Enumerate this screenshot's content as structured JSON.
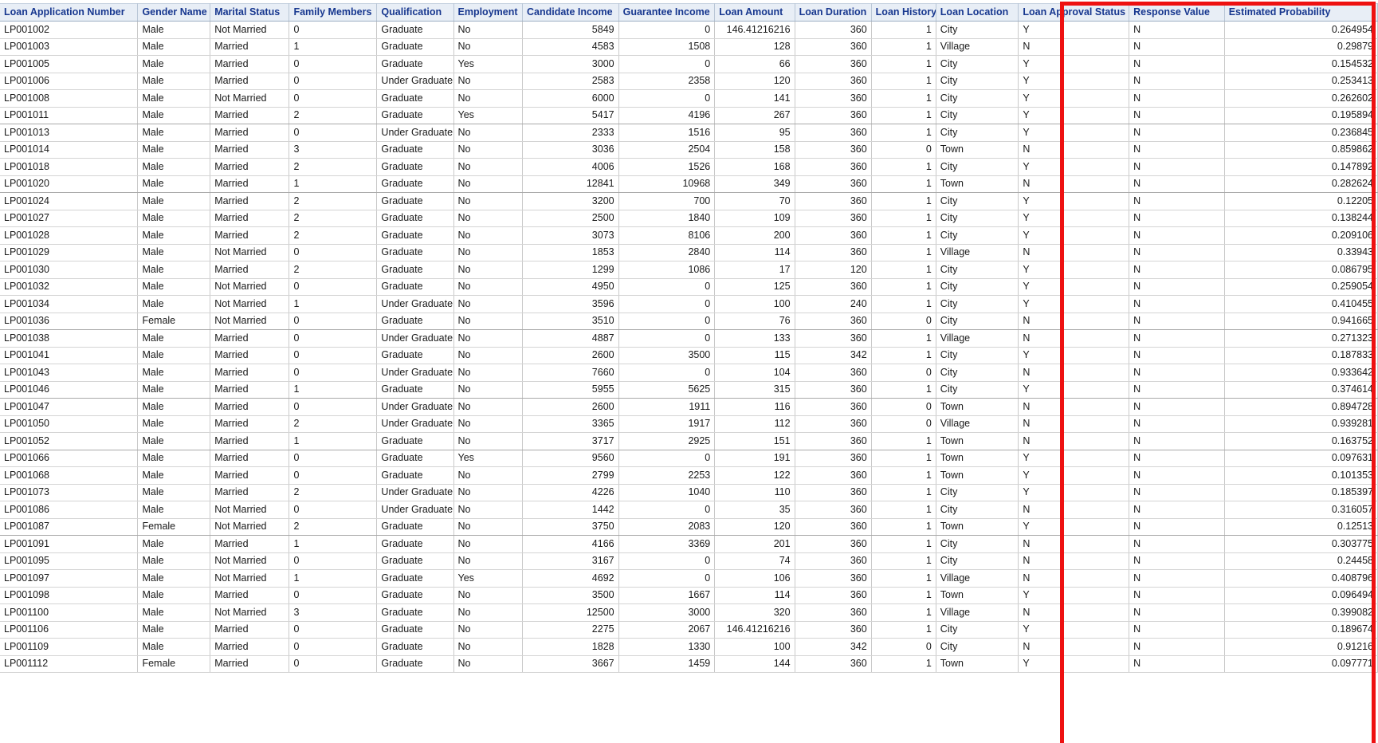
{
  "table": {
    "columns": [
      {
        "key": "loan_application_number",
        "label": "Loan Application Number",
        "align": "left"
      },
      {
        "key": "gender_name",
        "label": "Gender Name",
        "align": "left"
      },
      {
        "key": "marital_status",
        "label": "Marital Status",
        "align": "left"
      },
      {
        "key": "family_members",
        "label": "Family Members",
        "align": "left"
      },
      {
        "key": "qualification",
        "label": "Qualification",
        "align": "left"
      },
      {
        "key": "employment",
        "label": "Employment",
        "align": "left"
      },
      {
        "key": "candidate_income",
        "label": "Candidate Income",
        "align": "right"
      },
      {
        "key": "guarantee_income",
        "label": "Guarantee Income",
        "align": "right"
      },
      {
        "key": "loan_amount",
        "label": "Loan Amount",
        "align": "right"
      },
      {
        "key": "loan_duration",
        "label": "Loan Duration",
        "align": "right"
      },
      {
        "key": "loan_history",
        "label": "Loan History",
        "align": "right"
      },
      {
        "key": "loan_location",
        "label": "Loan Location",
        "align": "left"
      },
      {
        "key": "loan_approval_status",
        "label": "Loan Approval Status",
        "align": "left"
      },
      {
        "key": "response_value",
        "label": "Response Value",
        "align": "left"
      },
      {
        "key": "estimated_probability",
        "label": "Estimated Probability",
        "align": "right"
      }
    ],
    "rows": [
      [
        "LP001002",
        "Male",
        "Not Married",
        "0",
        "Graduate",
        "No",
        "5849",
        "0",
        "146.41216216",
        "360",
        "1",
        "City",
        "Y",
        "N",
        "0.264954"
      ],
      [
        "LP001003",
        "Male",
        "Married",
        "1",
        "Graduate",
        "No",
        "4583",
        "1508",
        "128",
        "360",
        "1",
        "Village",
        "N",
        "N",
        "0.29879"
      ],
      [
        "LP001005",
        "Male",
        "Married",
        "0",
        "Graduate",
        "Yes",
        "3000",
        "0",
        "66",
        "360",
        "1",
        "City",
        "Y",
        "N",
        "0.154532"
      ],
      [
        "LP001006",
        "Male",
        "Married",
        "0",
        "Under Graduate",
        "No",
        "2583",
        "2358",
        "120",
        "360",
        "1",
        "City",
        "Y",
        "N",
        "0.253413"
      ],
      [
        "LP001008",
        "Male",
        "Not Married",
        "0",
        "Graduate",
        "No",
        "6000",
        "0",
        "141",
        "360",
        "1",
        "City",
        "Y",
        "N",
        "0.262602"
      ],
      [
        "LP001011",
        "Male",
        "Married",
        "2",
        "Graduate",
        "Yes",
        "5417",
        "4196",
        "267",
        "360",
        "1",
        "City",
        "Y",
        "N",
        "0.195894"
      ],
      [
        "LP001013",
        "Male",
        "Married",
        "0",
        "Under Graduate",
        "No",
        "2333",
        "1516",
        "95",
        "360",
        "1",
        "City",
        "Y",
        "N",
        "0.236845"
      ],
      [
        "LP001014",
        "Male",
        "Married",
        "3",
        "Graduate",
        "No",
        "3036",
        "2504",
        "158",
        "360",
        "0",
        "Town",
        "N",
        "N",
        "0.859862"
      ],
      [
        "LP001018",
        "Male",
        "Married",
        "2",
        "Graduate",
        "No",
        "4006",
        "1526",
        "168",
        "360",
        "1",
        "City",
        "Y",
        "N",
        "0.147892"
      ],
      [
        "LP001020",
        "Male",
        "Married",
        "1",
        "Graduate",
        "No",
        "12841",
        "10968",
        "349",
        "360",
        "1",
        "Town",
        "N",
        "N",
        "0.282624"
      ],
      [
        "LP001024",
        "Male",
        "Married",
        "2",
        "Graduate",
        "No",
        "3200",
        "700",
        "70",
        "360",
        "1",
        "City",
        "Y",
        "N",
        "0.12205"
      ],
      [
        "LP001027",
        "Male",
        "Married",
        "2",
        "Graduate",
        "No",
        "2500",
        "1840",
        "109",
        "360",
        "1",
        "City",
        "Y",
        "N",
        "0.138244"
      ],
      [
        "LP001028",
        "Male",
        "Married",
        "2",
        "Graduate",
        "No",
        "3073",
        "8106",
        "200",
        "360",
        "1",
        "City",
        "Y",
        "N",
        "0.209106"
      ],
      [
        "LP001029",
        "Male",
        "Not Married",
        "0",
        "Graduate",
        "No",
        "1853",
        "2840",
        "114",
        "360",
        "1",
        "Village",
        "N",
        "N",
        "0.33943"
      ],
      [
        "LP001030",
        "Male",
        "Married",
        "2",
        "Graduate",
        "No",
        "1299",
        "1086",
        "17",
        "120",
        "1",
        "City",
        "Y",
        "N",
        "0.086795"
      ],
      [
        "LP001032",
        "Male",
        "Not Married",
        "0",
        "Graduate",
        "No",
        "4950",
        "0",
        "125",
        "360",
        "1",
        "City",
        "Y",
        "N",
        "0.259054"
      ],
      [
        "LP001034",
        "Male",
        "Not Married",
        "1",
        "Under Graduate",
        "No",
        "3596",
        "0",
        "100",
        "240",
        "1",
        "City",
        "Y",
        "N",
        "0.410455"
      ],
      [
        "LP001036",
        "Female",
        "Not Married",
        "0",
        "Graduate",
        "No",
        "3510",
        "0",
        "76",
        "360",
        "0",
        "City",
        "N",
        "N",
        "0.941665"
      ],
      [
        "LP001038",
        "Male",
        "Married",
        "0",
        "Under Graduate",
        "No",
        "4887",
        "0",
        "133",
        "360",
        "1",
        "Village",
        "N",
        "N",
        "0.271323"
      ],
      [
        "LP001041",
        "Male",
        "Married",
        "0",
        "Graduate",
        "No",
        "2600",
        "3500",
        "115",
        "342",
        "1",
        "City",
        "Y",
        "N",
        "0.187833"
      ],
      [
        "LP001043",
        "Male",
        "Married",
        "0",
        "Under Graduate",
        "No",
        "7660",
        "0",
        "104",
        "360",
        "0",
        "City",
        "N",
        "N",
        "0.933642"
      ],
      [
        "LP001046",
        "Male",
        "Married",
        "1",
        "Graduate",
        "No",
        "5955",
        "5625",
        "315",
        "360",
        "1",
        "City",
        "Y",
        "N",
        "0.374614"
      ],
      [
        "LP001047",
        "Male",
        "Married",
        "0",
        "Under Graduate",
        "No",
        "2600",
        "1911",
        "116",
        "360",
        "0",
        "Town",
        "N",
        "N",
        "0.894728"
      ],
      [
        "LP001050",
        "Male",
        "Married",
        "2",
        "Under Graduate",
        "No",
        "3365",
        "1917",
        "112",
        "360",
        "0",
        "Village",
        "N",
        "N",
        "0.939281"
      ],
      [
        "LP001052",
        "Male",
        "Married",
        "1",
        "Graduate",
        "No",
        "3717",
        "2925",
        "151",
        "360",
        "1",
        "Town",
        "N",
        "N",
        "0.163752"
      ],
      [
        "LP001066",
        "Male",
        "Married",
        "0",
        "Graduate",
        "Yes",
        "9560",
        "0",
        "191",
        "360",
        "1",
        "Town",
        "Y",
        "N",
        "0.097631"
      ],
      [
        "LP001068",
        "Male",
        "Married",
        "0",
        "Graduate",
        "No",
        "2799",
        "2253",
        "122",
        "360",
        "1",
        "Town",
        "Y",
        "N",
        "0.101353"
      ],
      [
        "LP001073",
        "Male",
        "Married",
        "2",
        "Under Graduate",
        "No",
        "4226",
        "1040",
        "110",
        "360",
        "1",
        "City",
        "Y",
        "N",
        "0.185397"
      ],
      [
        "LP001086",
        "Male",
        "Not Married",
        "0",
        "Under Graduate",
        "No",
        "1442",
        "0",
        "35",
        "360",
        "1",
        "City",
        "N",
        "N",
        "0.316057"
      ],
      [
        "LP001087",
        "Female",
        "Not Married",
        "2",
        "Graduate",
        "No",
        "3750",
        "2083",
        "120",
        "360",
        "1",
        "Town",
        "Y",
        "N",
        "0.12513"
      ],
      [
        "LP001091",
        "Male",
        "Married",
        "1",
        "Graduate",
        "No",
        "4166",
        "3369",
        "201",
        "360",
        "1",
        "City",
        "N",
        "N",
        "0.303775"
      ],
      [
        "LP001095",
        "Male",
        "Not Married",
        "0",
        "Graduate",
        "No",
        "3167",
        "0",
        "74",
        "360",
        "1",
        "City",
        "N",
        "N",
        "0.24458"
      ],
      [
        "LP001097",
        "Male",
        "Not Married",
        "1",
        "Graduate",
        "Yes",
        "4692",
        "0",
        "106",
        "360",
        "1",
        "Village",
        "N",
        "N",
        "0.408796"
      ],
      [
        "LP001098",
        "Male",
        "Married",
        "0",
        "Graduate",
        "No",
        "3500",
        "1667",
        "114",
        "360",
        "1",
        "Town",
        "Y",
        "N",
        "0.096494"
      ],
      [
        "LP001100",
        "Male",
        "Not Married",
        "3",
        "Graduate",
        "No",
        "12500",
        "3000",
        "320",
        "360",
        "1",
        "Village",
        "N",
        "N",
        "0.399082"
      ],
      [
        "LP001106",
        "Male",
        "Married",
        "0",
        "Graduate",
        "No",
        "2275",
        "2067",
        "146.41216216",
        "360",
        "1",
        "City",
        "Y",
        "N",
        "0.189674"
      ],
      [
        "LP001109",
        "Male",
        "Married",
        "0",
        "Graduate",
        "No",
        "1828",
        "1330",
        "100",
        "342",
        "0",
        "City",
        "N",
        "N",
        "0.91216"
      ],
      [
        "LP001112",
        "Female",
        "Married",
        "0",
        "Graduate",
        "No",
        "3667",
        "1459",
        "144",
        "360",
        "1",
        "Town",
        "Y",
        "N",
        "0.097771"
      ]
    ]
  },
  "annotation": {
    "highlight_color": "#ee1111",
    "highlighted_columns": [
      "Response Value",
      "Estimated Probability"
    ]
  },
  "colors": {
    "header_background": "#e8eef6",
    "header_text": "#17378f",
    "cell_text": "#1a1a1a",
    "grid_line": "#c9c9c9"
  }
}
